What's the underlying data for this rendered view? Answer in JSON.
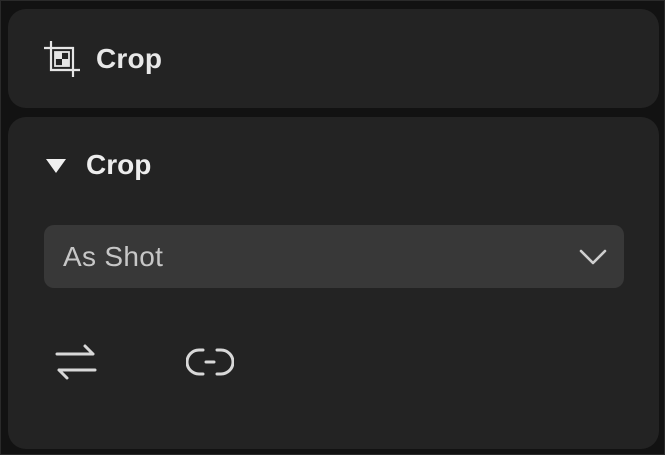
{
  "header": {
    "title": "Crop",
    "icon": "crop-icon"
  },
  "section": {
    "title": "Crop",
    "toggle_icon": "triangle-down-icon",
    "expanded": true
  },
  "aspect_select": {
    "value": "As Shot",
    "icon": "chevron-down-icon"
  },
  "tools": [
    {
      "icon": "swap-orientation-icon"
    },
    {
      "icon": "unlink-aspect-icon"
    }
  ],
  "colors": {
    "background": "#121212",
    "card": "#232323",
    "select": "#383838",
    "text": "#ededed",
    "muted_text": "#c7c7c7"
  }
}
